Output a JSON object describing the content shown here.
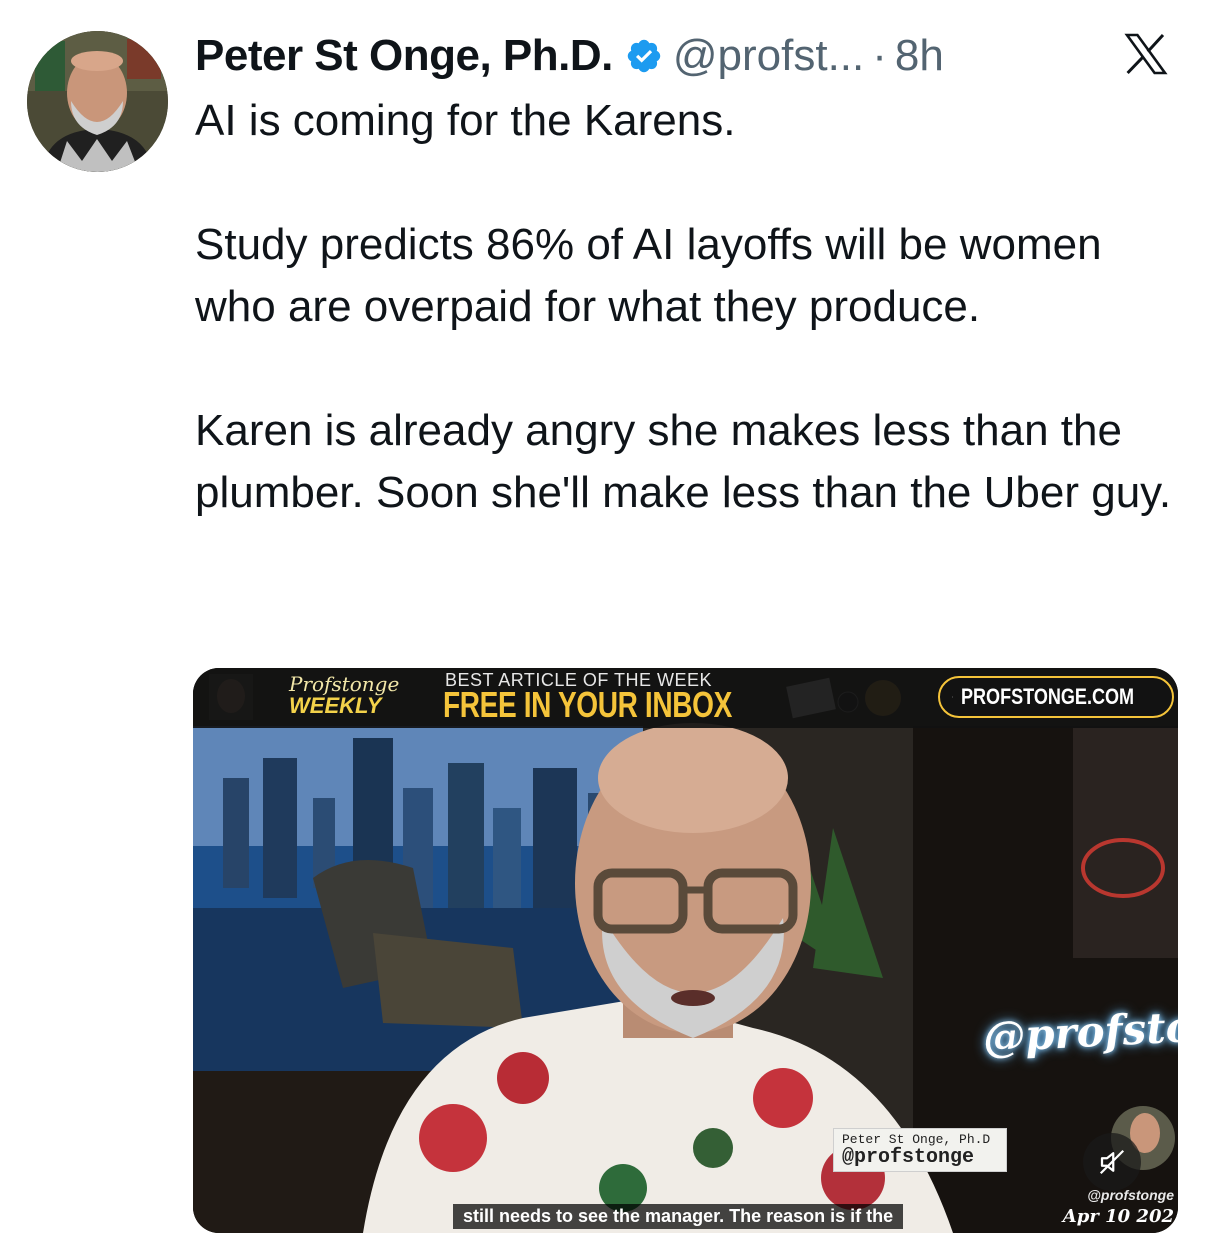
{
  "tweet": {
    "author_name": "Peter St Onge, Ph.D.",
    "handle": "@profst...",
    "separator": "·",
    "time": "8h",
    "verified_icon": "verified-badge-icon",
    "platform_icon": "x-logo-icon",
    "text_paragraphs": [
      "AI is coming for the Karens.",
      "Study predicts 86% of AI layoffs will be women who are overpaid for what they produce.",
      "Karen is already angry she makes less than the plumber. Soon she'll make less than the Uber guy."
    ]
  },
  "video": {
    "banner_script": "Profstonge",
    "banner_weekly": "WEEKLY",
    "banner_small": "BEST ARTICLE OF THE WEEK",
    "banner_big": "FREE IN YOUR INBOX",
    "site_pill": "PROFSTONGE.COM",
    "neon_sign": "@profstonge",
    "nametag_line1": "Peter St Onge, Ph.D",
    "nametag_line2": "@profstonge",
    "caption": "still needs to see the manager. The reason is if the",
    "corner_handle": "@profstonge",
    "corner_date": "Apr 10 202",
    "mute_icon": "muted-speaker-icon"
  },
  "colors": {
    "text": "#0f1419",
    "secondary": "#536471",
    "verified": "#1d9bf0",
    "banner_yellow": "#f5c43a"
  }
}
